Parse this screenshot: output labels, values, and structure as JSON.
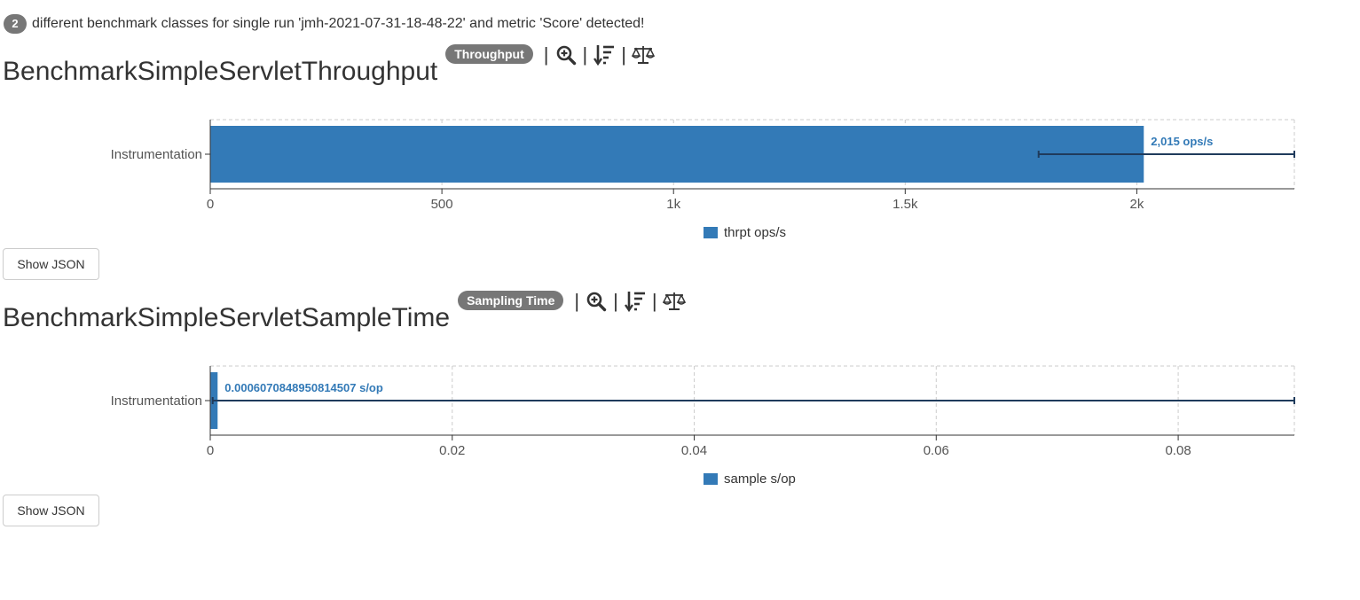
{
  "summary": {
    "count": "2",
    "text": "different benchmark classes for single run 'jmh-2021-07-31-18-48-22' and metric 'Score' detected!"
  },
  "colors": {
    "bar": "#337ab7",
    "badge": "#777777",
    "error_bar": "#1f3b5c"
  },
  "icons": [
    "zoom-in-icon",
    "sort-descending-icon",
    "balance-scale-icon"
  ],
  "benchmarks": [
    {
      "title": "BenchmarkSimpleServletThroughput",
      "mode_badge": "Throughput",
      "show_json_label": "Show JSON",
      "chart_data": {
        "type": "bar",
        "orientation": "horizontal",
        "categories": [
          "Instrumentation"
        ],
        "series": [
          {
            "name": "thrpt ops/s",
            "values": [
              2015
            ],
            "error_low": [
              1788
            ],
            "error_high": [
              2340
            ]
          }
        ],
        "value_label": "2,015 ops/s",
        "xlim": [
          0,
          2340
        ],
        "xticks": [
          0,
          500,
          1000,
          1500,
          2000
        ],
        "xtick_labels": [
          "0",
          "500",
          "1k",
          "1.5k",
          "2k"
        ],
        "grid": true,
        "legend": "bottom"
      }
    },
    {
      "title": "BenchmarkSimpleServletSampleTime",
      "mode_badge": "Sampling Time",
      "show_json_label": "Show JSON",
      "chart_data": {
        "type": "bar",
        "orientation": "horizontal",
        "categories": [
          "Instrumentation"
        ],
        "series": [
          {
            "name": "sample s/op",
            "values": [
              0.0006070848950814507
            ],
            "error_low": [
              0.0002
            ],
            "error_high": [
              0.0896
            ]
          }
        ],
        "value_label": "0.0006070848950814507 s/op",
        "xlim": [
          0,
          0.0896
        ],
        "xticks": [
          0,
          0.02,
          0.04,
          0.06,
          0.08
        ],
        "xtick_labels": [
          "0",
          "0.02",
          "0.04",
          "0.06",
          "0.08"
        ],
        "grid": true,
        "legend": "bottom"
      }
    }
  ]
}
